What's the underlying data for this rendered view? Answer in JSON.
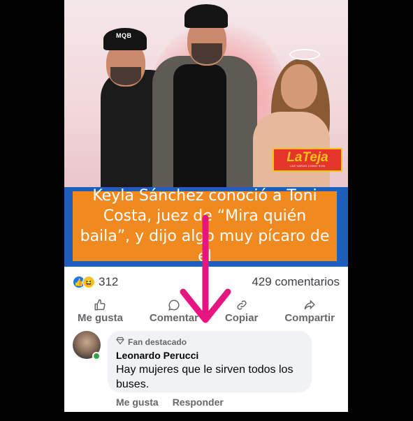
{
  "post": {
    "logo": {
      "main": "LaTeja",
      "sub": "LAS VARAS COMO SON"
    },
    "cap_text": "MQB",
    "headline": "Keyla Sánchez conoció a Toni Costa, juez de “Mira quién baila”, y dijo algo muy pícaro de él"
  },
  "reactions": {
    "count": "312",
    "comments": "429 comentarios"
  },
  "actions": [
    {
      "label": "Me gusta",
      "icon": "thumbs-up-icon"
    },
    {
      "label": "Comentar",
      "icon": "comment-icon"
    },
    {
      "label": "Copiar",
      "icon": "link-icon"
    },
    {
      "label": "Compartir",
      "icon": "share-icon"
    }
  ],
  "comment": {
    "badge": "Fan destacado",
    "author": "Leonardo Perucci",
    "text": "Hay mujeres que le sirven todos los buses.",
    "like_label": "Me gusta",
    "reply_label": "Responder"
  },
  "colors": {
    "accent_blue": "#1877f2",
    "banner_orange": "#f08a1f",
    "banner_blue": "#1f5fb8",
    "arrow_pink": "#e6157f"
  }
}
